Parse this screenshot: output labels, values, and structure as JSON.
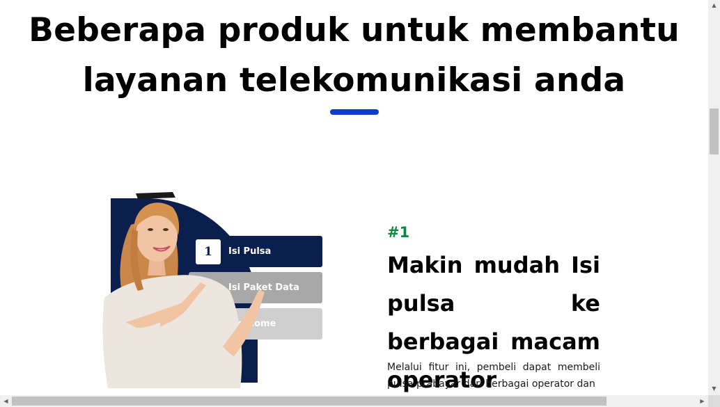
{
  "heading": {
    "line1": "Beberapa produk untuk membantu",
    "line2": "layanan telekomunikasi anda"
  },
  "illustration": {
    "cards": [
      {
        "number": "1",
        "label": "Isi Pulsa"
      },
      {
        "number": "",
        "label": "Isi Paket Data"
      },
      {
        "number": "",
        "label": "Indihome"
      }
    ]
  },
  "feature": {
    "number": "#1",
    "title": "Makin mudah Isi pulsa ke berbagai macam operator",
    "description": "Melalui fitur ini, pembeli dapat membeli pulsa prabayar dari berbagai operator dan"
  },
  "scrollbar": {
    "up_icon": "triangle-up",
    "down_icon": "triangle-down",
    "left_icon": "triangle-left",
    "right_icon": "triangle-right"
  },
  "colors": {
    "accent_bar": "#0b3fc4",
    "navy": "#0b1f4e",
    "step_number": "#0a8a3d"
  }
}
